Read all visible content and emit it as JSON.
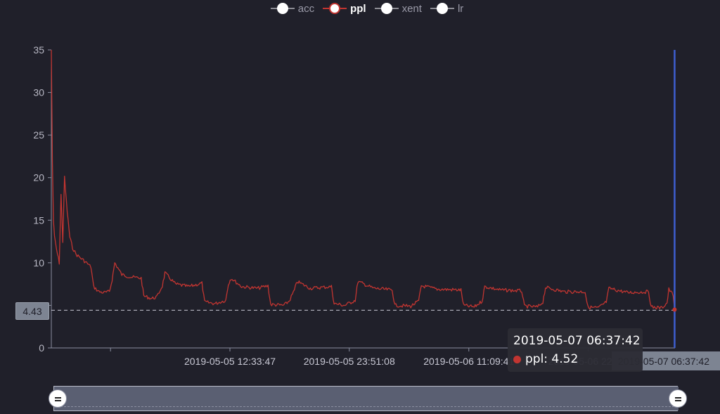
{
  "legend": [
    {
      "label": "acc",
      "active": false
    },
    {
      "label": "ppl",
      "active": true
    },
    {
      "label": "xent",
      "active": false
    },
    {
      "label": "lr",
      "active": false
    }
  ],
  "chart_data": {
    "type": "line",
    "series_name": "ppl",
    "color": "#c23531",
    "pointer_color": "#3d5fd0",
    "ylim": [
      0,
      35
    ],
    "y_ticks": [
      "0",
      "5",
      "10",
      "15",
      "20",
      "25",
      "30",
      "35"
    ],
    "x_tick_labels": [
      "2019-05-05 12:33:47",
      "2019-05-05 23:51:08",
      "2019-05-06 11:09:41",
      "2019-05-06 22:28:"
    ],
    "x_range": [
      "2019-05-04 19:40:00",
      "2019-05-07 06:40:00"
    ],
    "x_ticks_at": [
      "2019-05-05 01:16:00",
      "2019-05-05 12:33:47",
      "2019-05-05 23:51:08",
      "2019-05-06 11:09:41",
      "2019-05-06 22:28:00"
    ],
    "points": [
      [
        "2019-05-04 19:40:00",
        35.0
      ],
      [
        "2019-05-04 19:46:00",
        22.0
      ],
      [
        "2019-05-04 19:52:00",
        15.0
      ],
      [
        "2019-05-04 19:58:00",
        13.0
      ],
      [
        "2019-05-04 20:10:00",
        11.5
      ],
      [
        "2019-05-04 20:25:00",
        10.0
      ],
      [
        "2019-05-04 20:35:00",
        18.0
      ],
      [
        "2019-05-04 20:45:00",
        12.5
      ],
      [
        "2019-05-04 20:55:00",
        20.0
      ],
      [
        "2019-05-04 21:10:00",
        16.0
      ],
      [
        "2019-05-04 21:25:00",
        13.0
      ],
      [
        "2019-05-04 21:40:00",
        11.8
      ],
      [
        "2019-05-04 22:00:00",
        11.0
      ],
      [
        "2019-05-04 22:30:00",
        10.5
      ],
      [
        "2019-05-04 23:00:00",
        10.0
      ],
      [
        "2019-05-04 23:25:00",
        9.5
      ],
      [
        "2019-05-04 23:40:00",
        7.2
      ],
      [
        "2019-05-05 00:10:00",
        6.6
      ],
      [
        "2019-05-05 00:40:00",
        6.5
      ],
      [
        "2019-05-05 01:10:00",
        6.6
      ],
      [
        "2019-05-05 01:25:00",
        8.0
      ],
      [
        "2019-05-05 01:40:00",
        10.0
      ],
      [
        "2019-05-05 02:20:00",
        8.6
      ],
      [
        "2019-05-05 03:20:00",
        8.3
      ],
      [
        "2019-05-05 04:10:00",
        8.2
      ],
      [
        "2019-05-05 04:25:00",
        6.1
      ],
      [
        "2019-05-05 05:10:00",
        5.8
      ],
      [
        "2019-05-05 05:40:00",
        6.0
      ],
      [
        "2019-05-05 06:10:00",
        7.3
      ],
      [
        "2019-05-05 06:25:00",
        8.8
      ],
      [
        "2019-05-05 07:25:00",
        7.5
      ],
      [
        "2019-05-05 08:40:00",
        7.2
      ],
      [
        "2019-05-05 09:55:00",
        7.6
      ],
      [
        "2019-05-05 10:10:00",
        5.4
      ],
      [
        "2019-05-05 11:10:00",
        5.2
      ],
      [
        "2019-05-05 12:10:00",
        5.6
      ],
      [
        "2019-05-05 12:25:00",
        7.5
      ],
      [
        "2019-05-05 12:40:00",
        8.2
      ],
      [
        "2019-05-05 13:40:00",
        7.2
      ],
      [
        "2019-05-05 15:10:00",
        7.0
      ],
      [
        "2019-05-05 16:10:00",
        7.3
      ],
      [
        "2019-05-05 16:25:00",
        5.1
      ],
      [
        "2019-05-05 17:40:00",
        5.0
      ],
      [
        "2019-05-05 18:10:00",
        5.5
      ],
      [
        "2019-05-05 18:40:00",
        6.8
      ],
      [
        "2019-05-05 18:55:00",
        7.8
      ],
      [
        "2019-05-05 20:10:00",
        7.0
      ],
      [
        "2019-05-05 22:10:00",
        7.2
      ],
      [
        "2019-05-05 22:25:00",
        5.2
      ],
      [
        "2019-05-05 23:25:00",
        5.0
      ],
      [
        "2019-05-06 00:25:00",
        5.6
      ],
      [
        "2019-05-06 00:40:00",
        7.8
      ],
      [
        "2019-05-06 02:10:00",
        7.0
      ],
      [
        "2019-05-06 03:55:00",
        6.8
      ],
      [
        "2019-05-06 04:10:00",
        5.0
      ],
      [
        "2019-05-06 05:40:00",
        4.9
      ],
      [
        "2019-05-06 06:25:00",
        5.5
      ],
      [
        "2019-05-06 06:40:00",
        7.3
      ],
      [
        "2019-05-06 08:10:00",
        6.9
      ],
      [
        "2019-05-06 10:25:00",
        6.8
      ],
      [
        "2019-05-06 10:40:00",
        5.0
      ],
      [
        "2019-05-06 11:40:00",
        4.8
      ],
      [
        "2019-05-06 12:25:00",
        5.5
      ],
      [
        "2019-05-06 12:40:00",
        7.2
      ],
      [
        "2019-05-06 14:10:00",
        6.8
      ],
      [
        "2019-05-06 16:10:00",
        6.7
      ],
      [
        "2019-05-06 16:25:00",
        4.9
      ],
      [
        "2019-05-06 17:40:00",
        4.8
      ],
      [
        "2019-05-06 18:10:00",
        5.4
      ],
      [
        "2019-05-06 18:25:00",
        7.1
      ],
      [
        "2019-05-06 20:10:00",
        6.6
      ],
      [
        "2019-05-06 22:10:00",
        6.6
      ],
      [
        "2019-05-06 22:25:00",
        4.8
      ],
      [
        "2019-05-06 23:25:00",
        4.7
      ],
      [
        "2019-05-07 00:10:00",
        5.4
      ],
      [
        "2019-05-07 00:25:00",
        7.0
      ],
      [
        "2019-05-07 02:10:00",
        6.5
      ],
      [
        "2019-05-07 04:10:00",
        6.6
      ],
      [
        "2019-05-07 04:25:00",
        4.8
      ],
      [
        "2019-05-07 05:25:00",
        4.7
      ],
      [
        "2019-05-07 05:55:00",
        5.3
      ],
      [
        "2019-05-07 06:05:00",
        6.9
      ],
      [
        "2019-05-07 06:30:00",
        6.2
      ],
      [
        "2019-05-07 06:37:42",
        4.52
      ],
      [
        "2019-05-07 06:40:00",
        4.5
      ]
    ],
    "pointer": {
      "x": "2019-05-07 06:37:42",
      "y_label": "4.43",
      "y": 4.43
    }
  },
  "tooltip": {
    "time": "2019-05-07 06:37:42",
    "series": "ppl",
    "value": "4.52",
    "line": "ppl: 4.52"
  },
  "x_pointer_label": "2019-05-07 06:37:42",
  "data_zoom": {
    "start_pct": 0,
    "end_pct": 100
  }
}
